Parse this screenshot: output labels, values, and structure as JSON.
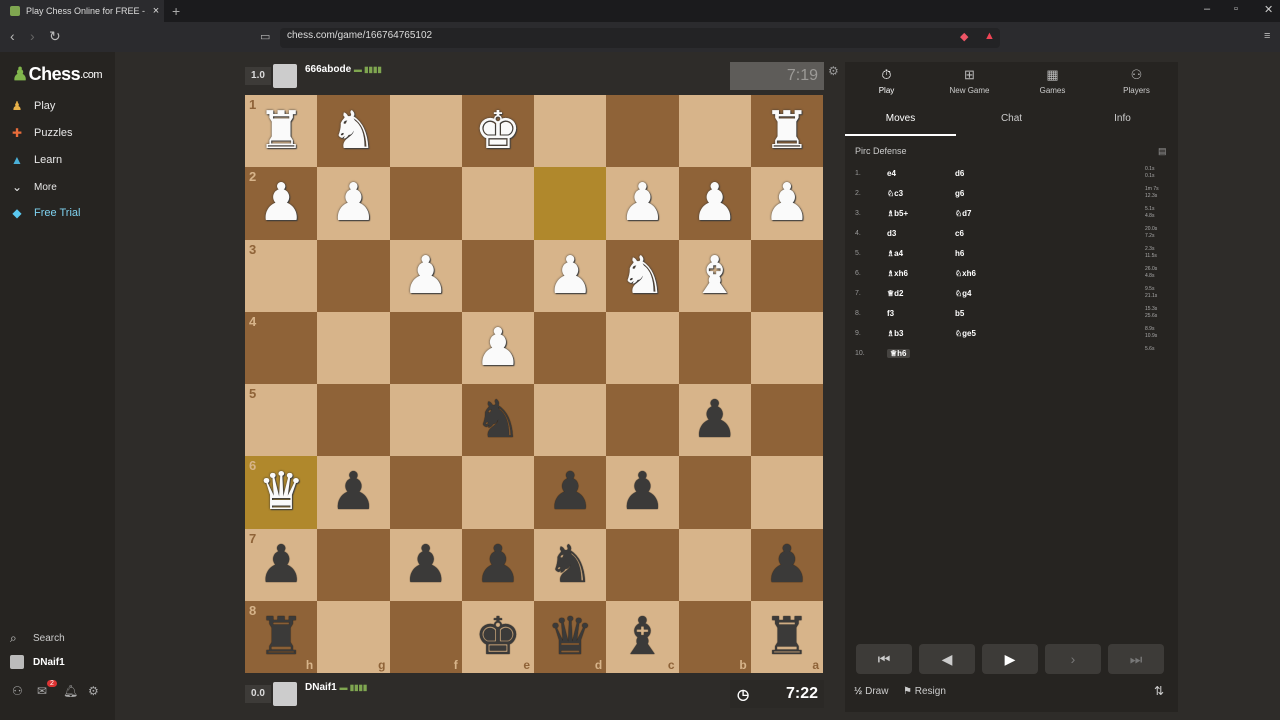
{
  "browser": {
    "tab_title": "Play Chess Online for FREE - 2 Pl",
    "url": "chess.com/game/166764765102"
  },
  "sidebar": {
    "logo": "Chess",
    "logo_suffix": ".com",
    "items": [
      {
        "label": "Play",
        "icon": "pawn-icon"
      },
      {
        "label": "Puzzles",
        "icon": "puzzle-icon"
      },
      {
        "label": "Learn",
        "icon": "graduation-cap-icon"
      },
      {
        "label": "More",
        "icon": "chevron-down-icon"
      },
      {
        "label": "Free Trial",
        "icon": "diamond-icon"
      }
    ],
    "search_label": "Search",
    "user_label": "DNaif1",
    "notification_count": "2"
  },
  "top_player": {
    "score": "1.0",
    "name": "666abode",
    "clock": "7:19"
  },
  "bottom_player": {
    "score": "0.0",
    "name": "DNaif1",
    "clock": "7:22"
  },
  "board": {
    "rank_labels": [
      "1",
      "2",
      "3",
      "4",
      "5",
      "6",
      "7",
      "8"
    ],
    "file_labels": [
      "h",
      "g",
      "f",
      "e",
      "d",
      "c",
      "b",
      "a"
    ],
    "rows": [
      [
        "wR",
        "wN",
        "",
        "wK",
        "",
        "",
        "",
        "wR"
      ],
      [
        "wP",
        "wP",
        "",
        "",
        "",
        "wP",
        "wP",
        "wP"
      ],
      [
        "",
        "",
        "wP",
        "",
        "wP",
        "wN",
        "wB",
        ""
      ],
      [
        "",
        "",
        "",
        "wP",
        "",
        "",
        "",
        ""
      ],
      [
        "",
        "",
        "",
        "bN",
        "",
        "",
        "bP",
        ""
      ],
      [
        "wQ",
        "bP",
        "",
        "",
        "bP",
        "bP",
        "",
        ""
      ],
      [
        "bP",
        "",
        "bP",
        "bP",
        "bN",
        "",
        "",
        "bP"
      ],
      [
        "bR",
        "",
        "",
        "bK",
        "bQ",
        "bB",
        "",
        "bR"
      ]
    ],
    "highlights": [
      "4,1",
      "0,5"
    ]
  },
  "panel": {
    "tabs": [
      {
        "label": "Play",
        "icon": "stopwatch-icon"
      },
      {
        "label": "New Game",
        "icon": "plus-icon"
      },
      {
        "label": "Games",
        "icon": "board-icon"
      },
      {
        "label": "Players",
        "icon": "players-icon"
      }
    ],
    "subtabs": [
      "Moves",
      "Chat",
      "Info"
    ],
    "opening": "Pirc Defense",
    "moves": [
      {
        "n": "1.",
        "w": "e4",
        "b": "d6",
        "wt": "0.1s",
        "bt": "0.1s"
      },
      {
        "n": "2.",
        "w": "♘c3",
        "b": "g6",
        "wt": "1m 7s",
        "bt": "12.3s"
      },
      {
        "n": "3.",
        "w": "♗b5+",
        "b": "♘d7",
        "wt": "5.1s",
        "bt": "4.8s"
      },
      {
        "n": "4.",
        "w": "d3",
        "b": "c6",
        "wt": "20.0s",
        "bt": "7.2s"
      },
      {
        "n": "5.",
        "w": "♗a4",
        "b": "h6",
        "wt": "2.3s",
        "bt": "11.5s"
      },
      {
        "n": "6.",
        "w": "♗xh6",
        "b": "♘xh6",
        "wt": "26.0s",
        "bt": "4.8s"
      },
      {
        "n": "7.",
        "w": "♕d2",
        "b": "♘g4",
        "wt": "9.5s",
        "bt": "21.1s"
      },
      {
        "n": "8.",
        "w": "f3",
        "b": "b5",
        "wt": "15.3s",
        "bt": "25.6s"
      },
      {
        "n": "9.",
        "w": "♗b3",
        "b": "♘ge5",
        "wt": "8.9s",
        "bt": "10.9s"
      },
      {
        "n": "10.",
        "w": "♕h6",
        "b": "",
        "wt": "5.6s",
        "bt": ""
      }
    ],
    "draw_label": "Draw",
    "draw_prefix": "½",
    "resign_label": "Resign"
  }
}
